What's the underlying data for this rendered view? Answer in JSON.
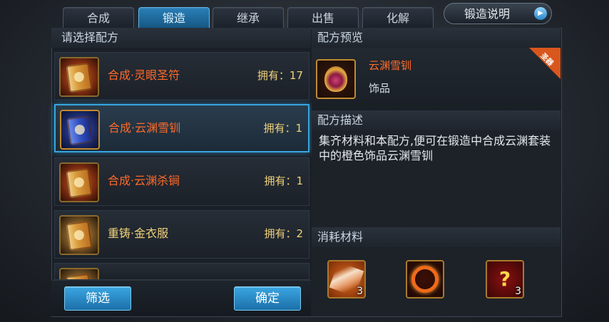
{
  "tabs": [
    {
      "label": "合成"
    },
    {
      "label": "锻造"
    },
    {
      "label": "继承"
    },
    {
      "label": "出售"
    },
    {
      "label": "化解"
    }
  ],
  "help_button": {
    "label": "锻造说明"
  },
  "left_panel": {
    "header": "请选择配方",
    "recipes": [
      {
        "name": "合成·灵眼圣符",
        "own": "拥有：17",
        "icon": "red-scroll-icon"
      },
      {
        "name": "合成·云渊雪钏",
        "own": "拥有：1",
        "icon": "blue-scroll-icon"
      },
      {
        "name": "合成·云渊杀锏",
        "own": "拥有：1",
        "icon": "orange-scroll-icon"
      },
      {
        "name": "重铸·金衣服",
        "own": "拥有：2",
        "icon": "gold-scroll-icon"
      }
    ],
    "filter_button": "筛选",
    "confirm_button": "确定"
  },
  "right_panel": {
    "preview_header": "配方预览",
    "item_name": "云渊雪钏",
    "item_type": "饰品",
    "corner_tag": "圣器",
    "desc_header": "配方描述",
    "description": "集齐材料和本配方,便可在锻造中合成云渊套装中的橙色饰品云渊雪钏",
    "materials_header": "消耗材料",
    "materials": [
      {
        "icon": "crystal-shard-icon",
        "count": "3"
      },
      {
        "icon": "fire-ring-icon",
        "count": ""
      },
      {
        "icon": "mystery-item-icon",
        "count": "3"
      }
    ]
  },
  "colors": {
    "accent_blue": "#36a6e0",
    "item_orange": "#ff6a2a",
    "label_gold": "#f0d27a"
  }
}
